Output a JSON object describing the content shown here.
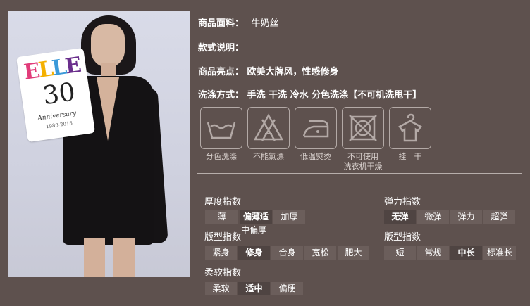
{
  "product": {
    "fabric_label": "商品面料：",
    "fabric_value": "牛奶丝",
    "style_label": "款式说明：",
    "style_value": "",
    "highlight_label": "商品亮点：",
    "highlight_value": "欧美大牌风，性感修身",
    "wash_label": "洗涤方式：",
    "wash_value": "手洗 干洗 冷水 分色洗涤【不可机洗甩干】"
  },
  "photo": {
    "card_logo": [
      "E",
      "L",
      "L",
      "E"
    ],
    "card_number": "30",
    "card_sub": "Anniversary",
    "card_years": "1988-2018"
  },
  "care_icons": [
    {
      "icon": "basin-wash-icon",
      "label": "分色洗涤"
    },
    {
      "icon": "no-bleach-icon",
      "label": "不能氯漂"
    },
    {
      "icon": "low-iron-icon",
      "label": "低温熨烫"
    },
    {
      "icon": "no-tumble-dry-icon",
      "label": "不可使用\n洗衣机干燥"
    },
    {
      "icon": "hang-dry-icon",
      "label": "挂　干"
    }
  ],
  "indices": {
    "thickness": {
      "title": "厚度指数",
      "options": [
        "薄",
        "偏薄适",
        "加厚"
      ],
      "overflow": "中偏厚",
      "selected": 1
    },
    "elasticity": {
      "title": "弹力指数",
      "options": [
        "无弹",
        "微弹",
        "弹力",
        "超弹"
      ],
      "selected": 0
    },
    "fit": {
      "title": "版型指数",
      "options": [
        "紧身",
        "修身",
        "合身",
        "宽松",
        "肥大"
      ],
      "selected": 1
    },
    "length": {
      "title": "版型指数",
      "options": [
        "短",
        "常规",
        "中长",
        "标准长"
      ],
      "selected": 2
    },
    "softness": {
      "title": "柔软指数",
      "options": [
        "柔软",
        "适中",
        "偏硬"
      ],
      "selected": 1
    }
  },
  "colors": {
    "background": "#5e514e",
    "option_bg": "#6b5e5b",
    "option_selected_bg": "#4f4442",
    "icon_stroke": "#b3a9a6"
  }
}
